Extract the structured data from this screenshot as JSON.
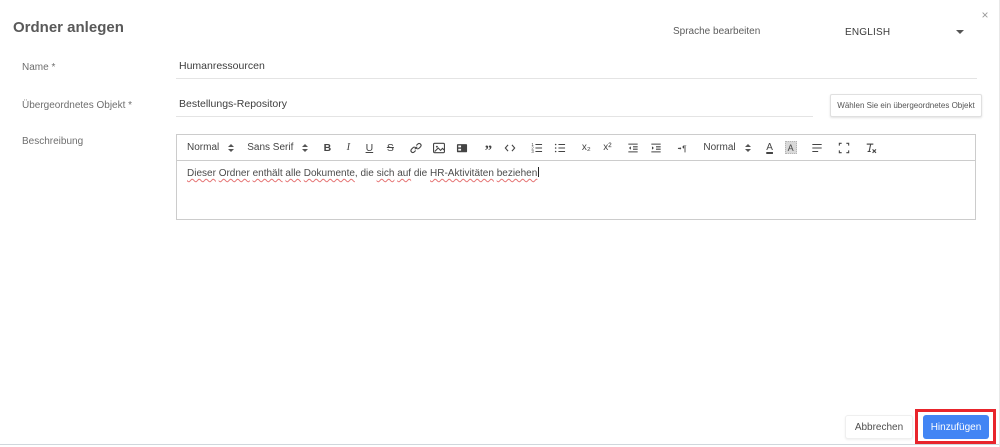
{
  "dialog": {
    "title": "Ordner anlegen",
    "close_glyph": "×",
    "language_label": "Sprache bearbeiten",
    "language_value": "ENGLISH"
  },
  "form": {
    "name_label": "Name *",
    "name_value": "Humanressourcen",
    "parent_label": "Übergeordnetes Objekt  *",
    "parent_value": "Bestellungs-Repository",
    "parent_button": "Wählen Sie ein übergeordnetes Objekt",
    "description_label": "Beschreibung",
    "description": {
      "toolbar": {
        "groups": [
          {
            "items": [
              {
                "type": "picker",
                "name": "header-picker",
                "label": "Normal"
              }
            ]
          },
          {
            "items": [
              {
                "type": "picker",
                "name": "font-picker",
                "label": "Sans Serif"
              }
            ]
          },
          {
            "items": [
              {
                "type": "glyph",
                "name": "bold-button",
                "glyph": "B",
                "cls": "g-bold"
              },
              {
                "type": "glyph",
                "name": "italic-button",
                "glyph": "I",
                "cls": "g-italic"
              },
              {
                "type": "glyph",
                "name": "underline-button",
                "glyph": "U",
                "cls": "g-underline"
              },
              {
                "type": "glyph",
                "name": "strike-button",
                "glyph": "S",
                "cls": "g-strike"
              }
            ]
          },
          {
            "items": [
              {
                "type": "icon",
                "name": "link-icon",
                "icon": "link"
              },
              {
                "type": "icon",
                "name": "image-icon",
                "icon": "image"
              },
              {
                "type": "icon",
                "name": "video-icon",
                "icon": "video"
              }
            ]
          },
          {
            "items": [
              {
                "type": "glyph",
                "name": "blockquote-button",
                "glyph": "”",
                "cls": "g-quote"
              },
              {
                "type": "icon",
                "name": "code-block-icon",
                "icon": "code"
              }
            ]
          },
          {
            "items": [
              {
                "type": "icon",
                "name": "ordered-list-icon",
                "icon": "listOrdered"
              },
              {
                "type": "icon",
                "name": "bullet-list-icon",
                "icon": "listBullet"
              }
            ]
          },
          {
            "items": [
              {
                "type": "glyph",
                "name": "subscript-button",
                "glyph": "x₂",
                "cls": "g-subsup"
              },
              {
                "type": "glyph",
                "name": "superscript-button",
                "glyph": "x²",
                "cls": "g-subsup"
              }
            ]
          },
          {
            "items": [
              {
                "type": "icon",
                "name": "outdent-icon",
                "icon": "outdent"
              },
              {
                "type": "icon",
                "name": "indent-icon",
                "icon": "indent"
              }
            ]
          },
          {
            "items": [
              {
                "type": "icon",
                "name": "direction-icon",
                "icon": "direction"
              }
            ]
          },
          {
            "items": [
              {
                "type": "picker",
                "name": "size-picker",
                "label": "Normal"
              }
            ]
          },
          {
            "items": [
              {
                "type": "glyph",
                "name": "text-color-button",
                "glyph": "A",
                "cls": "g-color"
              },
              {
                "type": "glyph",
                "name": "background-color-button",
                "glyph": "A",
                "cls": "g-bgcolor"
              }
            ]
          },
          {
            "items": [
              {
                "type": "icon",
                "name": "align-icon",
                "icon": "align"
              }
            ]
          },
          {
            "items": [
              {
                "type": "icon",
                "name": "fullscreen-icon",
                "icon": "fullscreen"
              }
            ]
          },
          {
            "items": [
              {
                "type": "icon",
                "name": "clean-format-icon",
                "icon": "clean"
              }
            ]
          }
        ]
      },
      "content": {
        "text": "Dieser Ordner enthält alle Dokumente, die sich auf die HR-Aktivitäten beziehen",
        "tokens": [
          {
            "text": "Dieser",
            "misspelled": true
          },
          {
            "text": "Ordner",
            "misspelled": true
          },
          {
            "text": "enthält",
            "misspelled": true
          },
          {
            "text": "alle",
            "misspelled": true
          },
          {
            "text": "Dokumente",
            "misspelled": true
          },
          {
            "text": ",",
            "glue": true
          },
          {
            "text": "die"
          },
          {
            "text": "sich",
            "misspelled": true
          },
          {
            "text": "auf",
            "misspelled": true
          },
          {
            "text": "die"
          },
          {
            "text": "HR-Aktivitäten",
            "misspelled": true
          },
          {
            "text": "beziehen",
            "misspelled": true
          }
        ]
      }
    }
  },
  "footer": {
    "cancel": "Abbrechen",
    "submit": "Hinzufügen"
  },
  "colors": {
    "accent_blue": "#4285f4",
    "annotation_red": "#e8252c",
    "border_gray": "#cccccc",
    "underline_gray": "#e4e4e4",
    "misspell_red": "#e57373"
  }
}
